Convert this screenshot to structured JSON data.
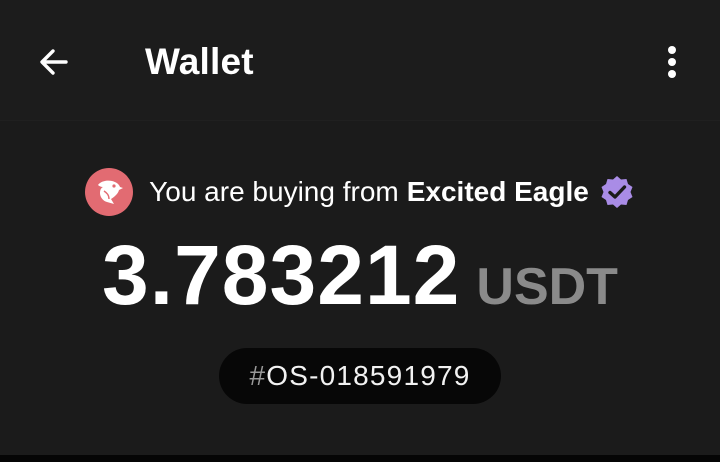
{
  "header": {
    "title": "Wallet",
    "back_icon": "arrow-left-icon",
    "menu_icon": "more-vertical-icon"
  },
  "seller": {
    "prefix": "You are buying from",
    "name": "Excited Eagle",
    "avatar_icon": "eagle-icon",
    "avatar_color": "#e26b72",
    "verified_icon": "verified-badge-icon",
    "verified_color": "#a98ce6"
  },
  "amount": {
    "value": "3.783212",
    "currency": "USDT"
  },
  "order": {
    "hash": "#",
    "id": "OS-018591979"
  },
  "colors": {
    "background": "#1b1b1b",
    "pill": "#070707",
    "muted": "#8a8a8a"
  }
}
